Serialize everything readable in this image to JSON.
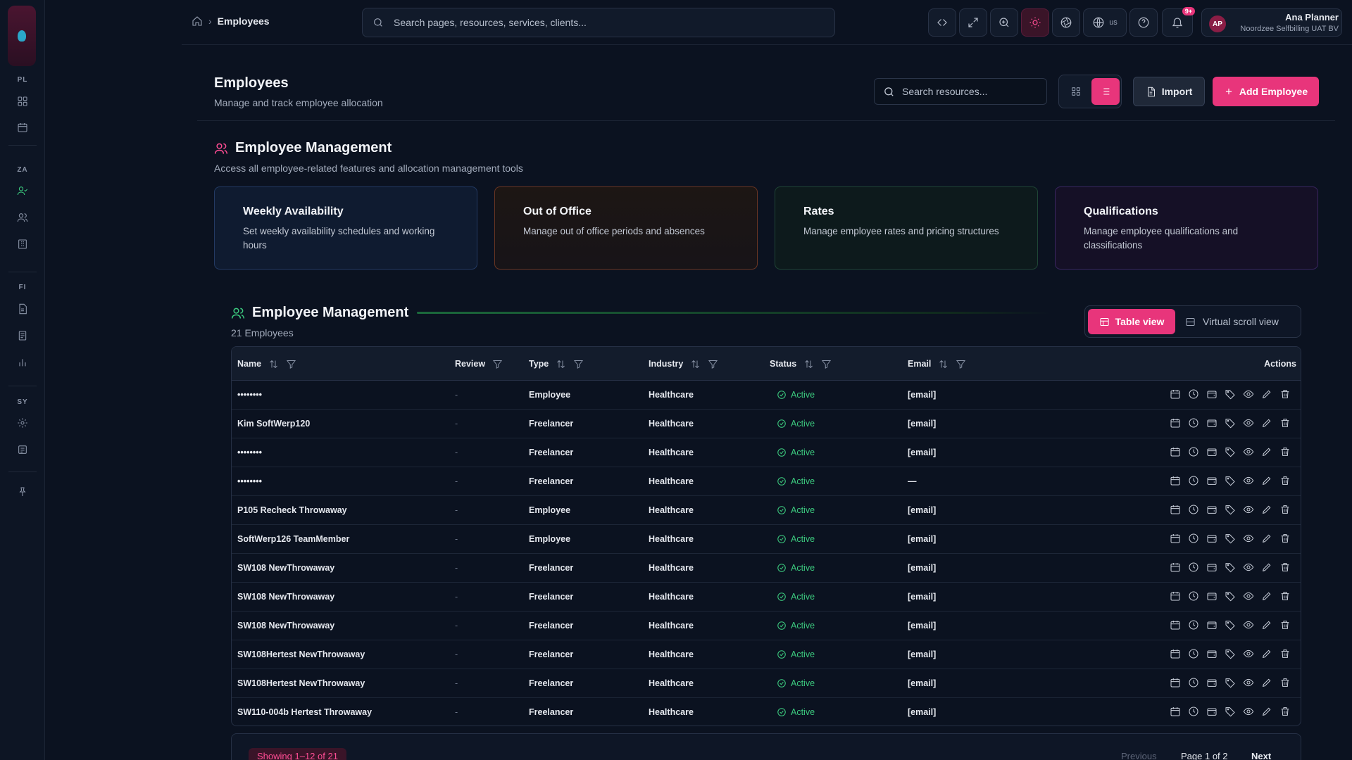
{
  "rail": {
    "sections": [
      "PL",
      "ZA",
      "FI",
      "SY"
    ]
  },
  "breadcrumb": {
    "current": "Employees"
  },
  "global_search": {
    "placeholder": "Search pages, resources, services, clients..."
  },
  "topbar": {
    "lang": "us",
    "notifications_badge": "9+"
  },
  "user": {
    "initials": "AP",
    "name": "Ana Planner",
    "company": "Noordzee Selfbilling UAT BV"
  },
  "page": {
    "title": "Employees",
    "subtitle": "Manage and track employee allocation"
  },
  "resource_search": {
    "placeholder": "Search resources..."
  },
  "buttons": {
    "import": "Import",
    "add": "Add Employee"
  },
  "management": {
    "title": "Employee Management",
    "subtitle": "Access all employee-related features and allocation management tools",
    "cards": [
      {
        "title": "Weekly Availability",
        "desc": "Set weekly availability schedules and working hours"
      },
      {
        "title": "Out of Office",
        "desc": "Manage out of office periods and absences"
      },
      {
        "title": "Rates",
        "desc": "Manage employee rates and pricing structures"
      },
      {
        "title": "Qualifications",
        "desc": "Manage employee qualifications and classifications"
      }
    ]
  },
  "table_section": {
    "title": "Employee Management",
    "count": "21 Employees",
    "view_table": "Table view",
    "view_virtual": "Virtual scroll view"
  },
  "table": {
    "columns": {
      "name": "Name",
      "review": "Review",
      "type": "Type",
      "industry": "Industry",
      "status": "Status",
      "email": "Email",
      "actions": "Actions"
    },
    "rows": [
      {
        "name": "••••••••",
        "review": "-",
        "type": "Employee",
        "industry": "Healthcare",
        "status": "Active",
        "email": "[email]"
      },
      {
        "name": "Kim SoftWerp120",
        "review": "-",
        "type": "Freelancer",
        "industry": "Healthcare",
        "status": "Active",
        "email": "[email]"
      },
      {
        "name": "••••••••",
        "review": "-",
        "type": "Freelancer",
        "industry": "Healthcare",
        "status": "Active",
        "email": "[email]"
      },
      {
        "name": "••••••••",
        "review": "-",
        "type": "Freelancer",
        "industry": "Healthcare",
        "status": "Active",
        "email": "—"
      },
      {
        "name": "P105 Recheck Throwaway",
        "review": "-",
        "type": "Employee",
        "industry": "Healthcare",
        "status": "Active",
        "email": "[email]"
      },
      {
        "name": "SoftWerp126 TeamMember",
        "review": "-",
        "type": "Employee",
        "industry": "Healthcare",
        "status": "Active",
        "email": "[email]"
      },
      {
        "name": "SW108 NewThrowaway",
        "review": "-",
        "type": "Freelancer",
        "industry": "Healthcare",
        "status": "Active",
        "email": "[email]"
      },
      {
        "name": "SW108 NewThrowaway",
        "review": "-",
        "type": "Freelancer",
        "industry": "Healthcare",
        "status": "Active",
        "email": "[email]"
      },
      {
        "name": "SW108 NewThrowaway",
        "review": "-",
        "type": "Freelancer",
        "industry": "Healthcare",
        "status": "Active",
        "email": "[email]"
      },
      {
        "name": "SW108Hertest NewThrowaway",
        "review": "-",
        "type": "Freelancer",
        "industry": "Healthcare",
        "status": "Active",
        "email": "[email]"
      },
      {
        "name": "SW108Hertest NewThrowaway",
        "review": "-",
        "type": "Freelancer",
        "industry": "Healthcare",
        "status": "Active",
        "email": "[email]"
      },
      {
        "name": "SW110-004b Hertest Throwaway",
        "review": "-",
        "type": "Freelancer",
        "industry": "Healthcare",
        "status": "Active",
        "email": "[email]"
      }
    ]
  },
  "pagination": {
    "showing": "Showing 1–12 of 21",
    "previous": "Previous",
    "page_info": "Page 1 of 2",
    "next": "Next"
  }
}
